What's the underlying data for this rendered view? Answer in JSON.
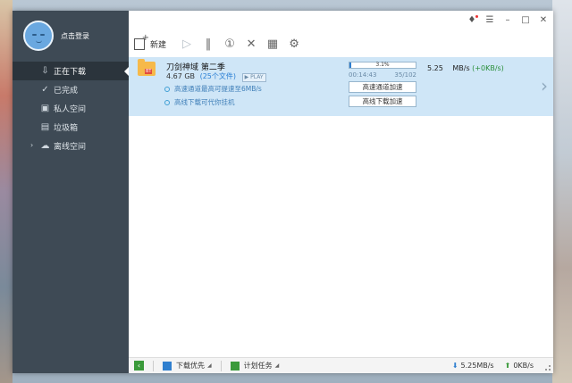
{
  "sidebar": {
    "login_label": "点击登录",
    "items": [
      {
        "label": "正在下载",
        "icon": "download-icon"
      },
      {
        "label": "已完成",
        "icon": "check-circle-icon"
      },
      {
        "label": "私人空间",
        "icon": "lock-icon"
      },
      {
        "label": "垃圾箱",
        "icon": "trash-icon"
      },
      {
        "label": "离线空间",
        "icon": "cloud-icon"
      }
    ]
  },
  "toolbar": {
    "new_label": "新建"
  },
  "task": {
    "name": "刀剑神域 第二季",
    "size": "4.67 GB",
    "files": "(25个文件)",
    "play_tag": "PLAY",
    "progress_pct": "3.1%",
    "progress_value": 3.1,
    "elapsed": "00:14:43",
    "count": "35/102",
    "speed": "5.25",
    "speed_unit": "MB/s",
    "upload_speed": "(+0KB/s)",
    "hint1": "高速通道最高可提速至6MB/s",
    "hint2": "高线下载可代你挂机",
    "btn_high_speed": "高速通道加速",
    "btn_offline": "高线下载加速",
    "tag_bt": "BT"
  },
  "statusbar": {
    "priority_label": "下载优先",
    "schedule_label": "计划任务",
    "down_speed": "5.25MB/s",
    "up_speed": "0KB/s"
  },
  "colors": {
    "sidebar_bg": "#3e4a55",
    "active_row": "#cfe6f7",
    "accent": "#2f7fcf"
  }
}
